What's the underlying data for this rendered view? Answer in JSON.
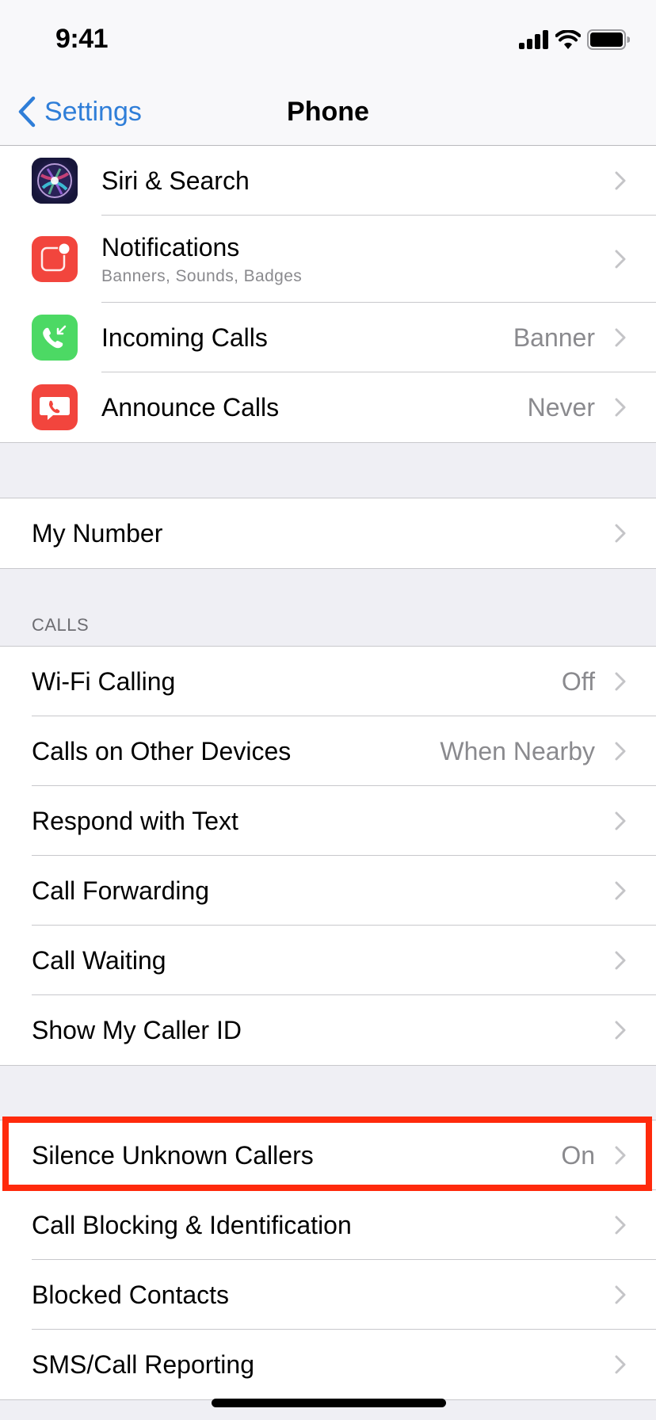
{
  "status_bar": {
    "time": "9:41",
    "icons": [
      "cellular-signal-icon",
      "wifi-icon",
      "battery-icon"
    ]
  },
  "nav": {
    "back_label": "Settings",
    "back_icon": "chevron-left-icon",
    "title": "Phone"
  },
  "groups": {
    "apps": [
      {
        "label": "Siri & Search",
        "icon": "siri-icon",
        "value": "",
        "sublabel": ""
      },
      {
        "label": "Notifications",
        "icon": "notifications-icon",
        "value": "",
        "sublabel": "Banners, Sounds, Badges"
      },
      {
        "label": "Incoming Calls",
        "icon": "incoming-call-icon",
        "value": "Banner",
        "sublabel": ""
      },
      {
        "label": "Announce Calls",
        "icon": "announce-calls-icon",
        "value": "Never",
        "sublabel": ""
      }
    ],
    "number": [
      {
        "label": "My Number",
        "value": ""
      }
    ],
    "calls_header": "CALLS",
    "calls": [
      {
        "label": "Wi-Fi Calling",
        "value": "Off"
      },
      {
        "label": "Calls on Other Devices",
        "value": "When Nearby"
      },
      {
        "label": "Respond with Text",
        "value": ""
      },
      {
        "label": "Call Forwarding",
        "value": ""
      },
      {
        "label": "Call Waiting",
        "value": ""
      },
      {
        "label": "Show My Caller ID",
        "value": ""
      }
    ],
    "blocking": [
      {
        "label": "Silence Unknown Callers",
        "value": "On",
        "highlighted": true
      },
      {
        "label": "Call Blocking & Identification",
        "value": ""
      },
      {
        "label": "Blocked Contacts",
        "value": ""
      },
      {
        "label": "SMS/Call Reporting",
        "value": ""
      }
    ]
  },
  "colors": {
    "accent": "#2f7ed8",
    "highlight": "#ff2a0c",
    "background": "#efeff4",
    "secondary_text": "#8a8a8e",
    "notifications_red": "#f2453d",
    "incoming_green": "#4cd964"
  }
}
